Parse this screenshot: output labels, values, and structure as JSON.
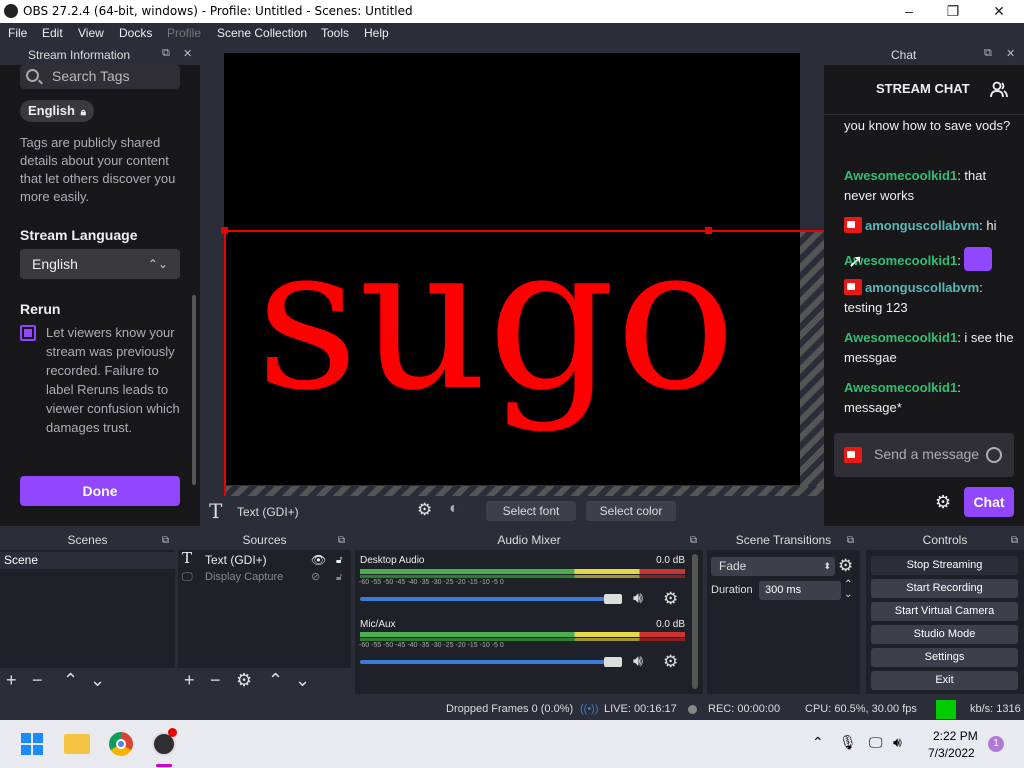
{
  "window": {
    "title": "OBS 27.2.4 (64-bit, windows) - Profile: Untitled - Scenes: Untitled",
    "minimize": "–",
    "maximize": "❐",
    "close": "✕"
  },
  "menu": [
    "File",
    "Edit",
    "View",
    "Docks",
    "Profile",
    "Scene Collection",
    "Tools",
    "Help"
  ],
  "stream_info": {
    "title": "Stream Information",
    "search_placeholder": "Search Tags",
    "tag": "English",
    "tags_description": "Tags are publicly shared details about your content that let others discover you more easily.",
    "language_label": "Stream Language",
    "language_value": "English",
    "rerun_label": "Rerun",
    "rerun_description": "Let viewers know your stream was previously recorded. Failure to label Reruns leads to viewer confusion which damages trust.",
    "done": "Done"
  },
  "preview": {
    "text": "sugo"
  },
  "source_toolbar": {
    "source_name": "Text (GDI+)",
    "select_font": "Select font",
    "select_color": "Select color"
  },
  "chat": {
    "dock_title": "Chat",
    "header": "STREAM CHAT",
    "messages": [
      {
        "user": "",
        "text": "you know how to save vods?"
      },
      {
        "user": "Awesomecoolkid1",
        "text": ": that never works"
      },
      {
        "user": "amonguscollabvm",
        "text": ": hi"
      },
      {
        "user": "Awesomecoolkid1",
        "text": ":"
      },
      {
        "user": "amonguscollabvm",
        "text": ": testing 123"
      },
      {
        "user": "Awesomecoolkid1",
        "text": ": i see the messgae"
      },
      {
        "user": "Awesomecoolkid1",
        "text": ": message*"
      }
    ],
    "input_placeholder": "Send a message",
    "send": "Chat",
    "colors": {
      "green_user": "#2fbf71",
      "teal_user": "#5ab8b8",
      "accent": "#9147ff"
    }
  },
  "scenes": {
    "title": "Scenes",
    "items": [
      "Scene"
    ]
  },
  "sources": {
    "title": "Sources",
    "items": [
      {
        "name": "Text (GDI+)",
        "visible": true
      },
      {
        "name": "Display Capture",
        "visible": false
      }
    ]
  },
  "mixer": {
    "title": "Audio Mixer",
    "channels": [
      {
        "name": "Desktop Audio",
        "level": "0.0 dB",
        "volume": 0.95
      },
      {
        "name": "Mic/Aux",
        "level": "0.0 dB",
        "volume": 0.95
      }
    ],
    "ticks": "-60  -55  -50  -45  -40  -35  -30  -25  -20  -15  -10  -5   0"
  },
  "transitions": {
    "title": "Scene Transitions",
    "type": "Fade",
    "duration_label": "Duration",
    "duration_value": "300 ms"
  },
  "controls": {
    "title": "Controls",
    "buttons": [
      "Stop Streaming",
      "Start Recording",
      "Start Virtual Camera",
      "Studio Mode",
      "Settings",
      "Exit"
    ]
  },
  "status": {
    "dropped": "Dropped Frames 0 (0.0%)",
    "live": "LIVE: 00:16:17",
    "rec": "REC: 00:00:00",
    "cpu": "CPU: 60.5%, 30.00 fps",
    "kbs": "kb/s: 1316"
  },
  "taskbar": {
    "time": "2:22 PM",
    "date": "7/3/2022",
    "notification_count": "1"
  }
}
